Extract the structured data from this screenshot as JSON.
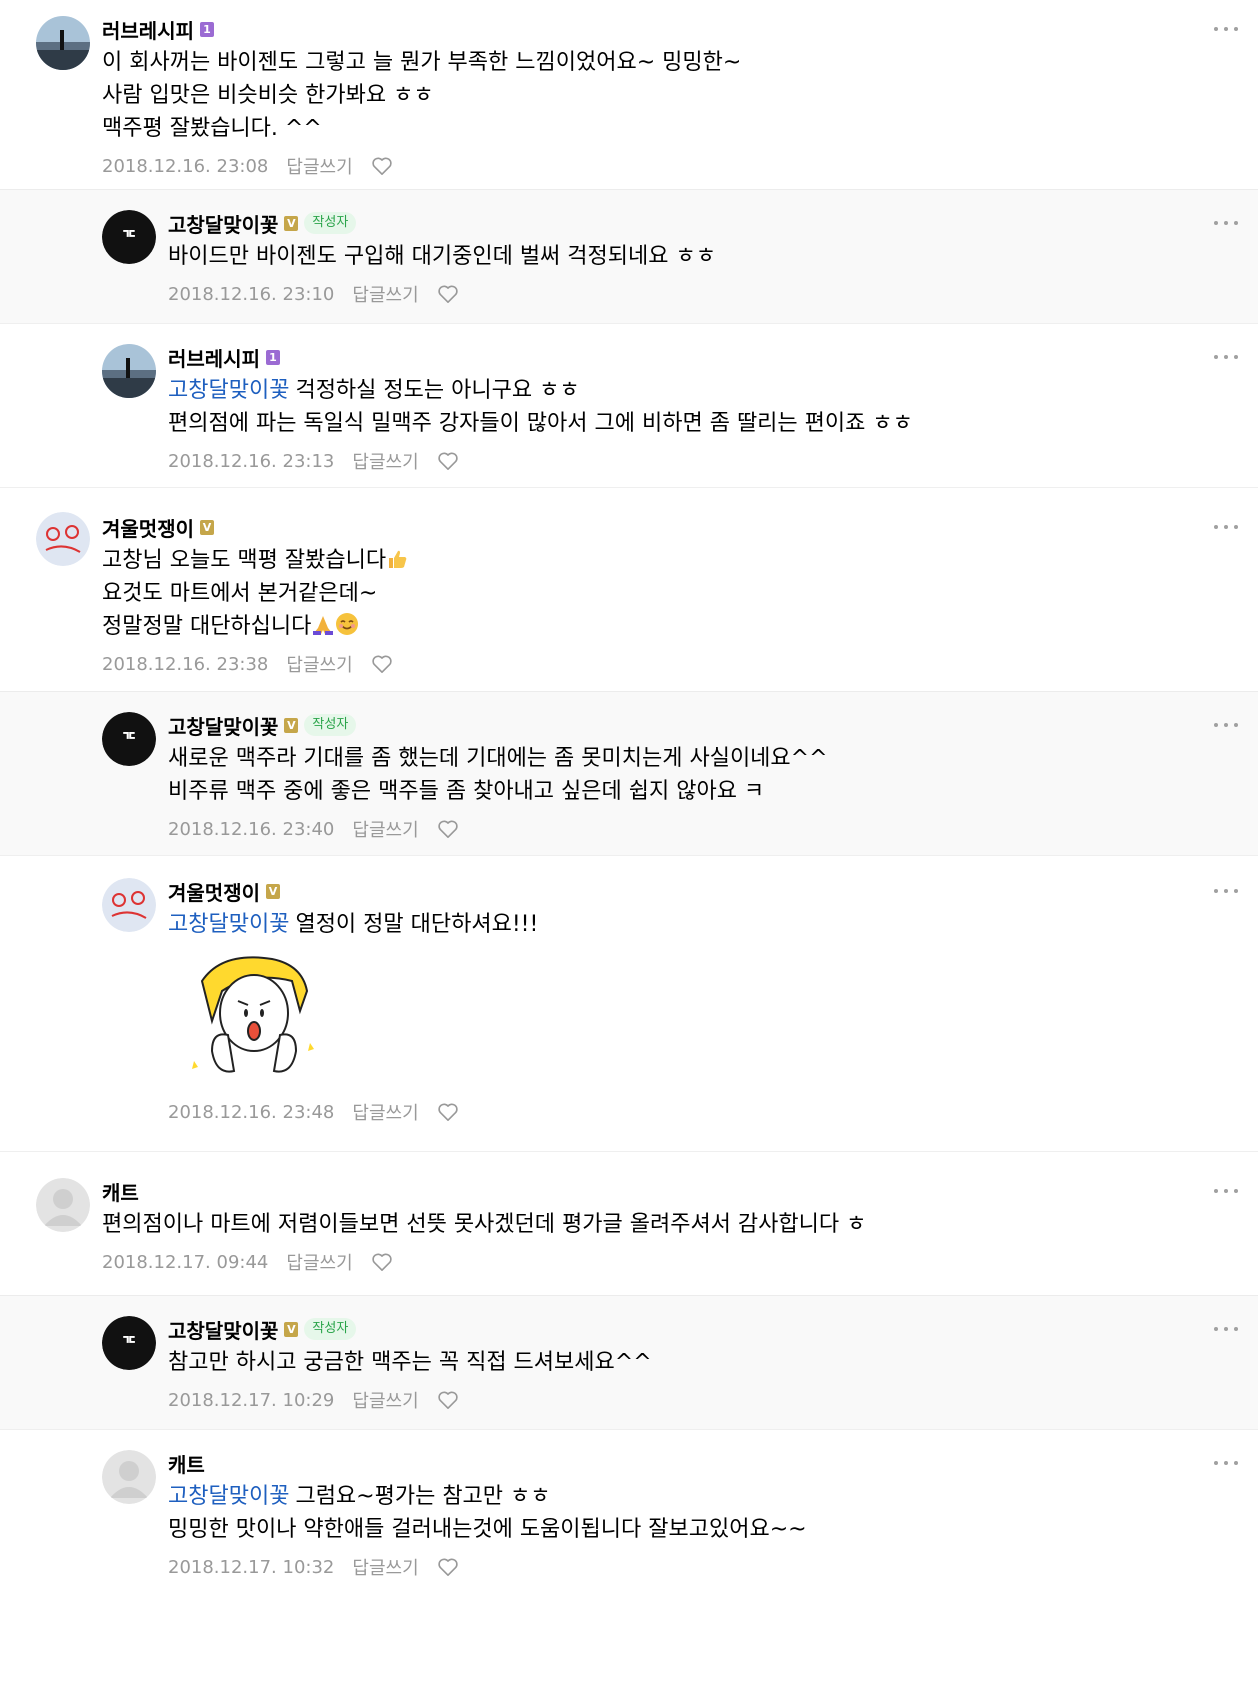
{
  "ui": {
    "reply_label": "답글쓰기",
    "author_badge": "작성자",
    "level_badge": "1",
    "verified_badge": "V"
  },
  "comments": [
    {
      "nick": "러브레시피",
      "lines": [
        "이 회사꺼는 바이젠도 그렇고 늘 뭔가 부족한 느낌이었어요~ 밍밍한~",
        "사람 입맛은 비슷비슷 한가봐요 ㅎㅎ",
        "맥주평 잘봤습니다. ^^"
      ],
      "date": "2018.12.16. 23:08"
    },
    {
      "nick": "고창달맞이꽃",
      "lines": [
        "바이드만 바이젠도 구입해 대기중인데 벌써 걱정되네요 ㅎㅎ"
      ],
      "date": "2018.12.16. 23:10"
    },
    {
      "nick": "러브레시피",
      "mention": "고창달맞이꽃",
      "first_line": "걱정하실 정도는 아니구요 ㅎㅎ",
      "lines": [
        "편의점에 파는 독일식 밀맥주 강자들이 많아서 그에 비하면 좀 딸리는 편이죠 ㅎㅎ"
      ],
      "date": "2018.12.16. 23:13"
    },
    {
      "nick": "겨울멋쟁이",
      "lines": [
        "고창님 오늘도 맥평 잘봤습니다",
        "요것도 마트에서 본거같은데~",
        "정말정말 대단하십니다"
      ],
      "date": "2018.12.16. 23:38"
    },
    {
      "nick": "고창달맞이꽃",
      "lines": [
        "새로운 맥주라 기대를 좀 했는데 기대에는 좀 못미치는게 사실이네요^^",
        "비주류 맥주 중에 좋은 맥주들 좀 찾아내고 싶은데 쉽지 않아요 ㅋ"
      ],
      "date": "2018.12.16. 23:40"
    },
    {
      "nick": "겨울멋쟁이",
      "mention": "고창달맞이꽃",
      "first_line": "열정이 정말 대단하셔요!!!",
      "date": "2018.12.16. 23:48"
    },
    {
      "nick": "캐트",
      "lines": [
        "편의점이나 마트에 저렴이들보면 선뜻 못사겠던데 평가글 올려주셔서 감사합니다 ㅎ"
      ],
      "date": "2018.12.17. 09:44"
    },
    {
      "nick": "고창달맞이꽃",
      "lines": [
        "참고만 하시고 궁금한 맥주는 꼭 직접 드셔보세요^^"
      ],
      "date": "2018.12.17. 10:29"
    },
    {
      "nick": "캐트",
      "mention": "고창달맞이꽃",
      "first_line": "그럼요~평가는 참고만 ㅎㅎ",
      "lines": [
        "밍밍한 맛이나 약한애들 걸러내는것에 도움이됩니다 잘보고있어요~~"
      ],
      "date": "2018.12.17. 10:32"
    }
  ]
}
